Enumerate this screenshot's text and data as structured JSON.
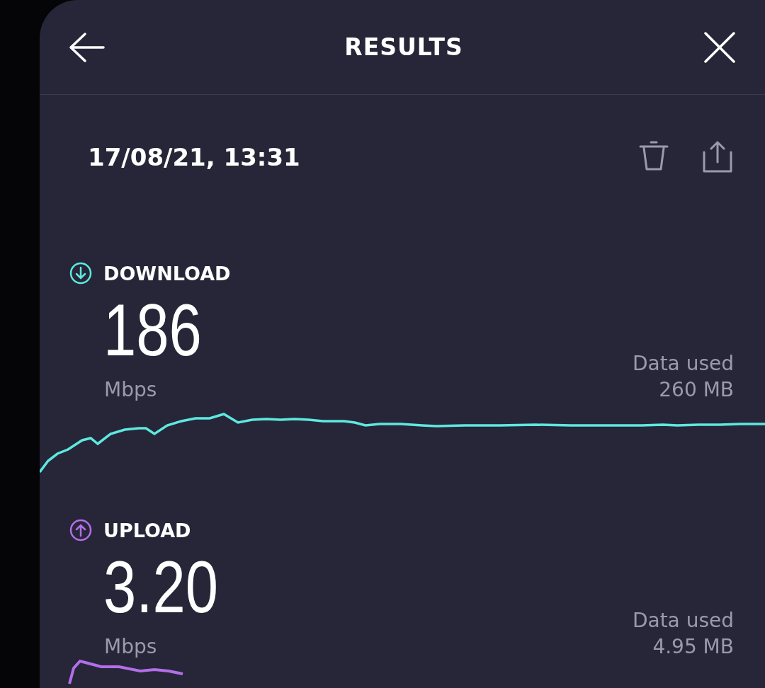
{
  "header": {
    "title": "RESULTS"
  },
  "result": {
    "timestamp": "17/08/21, 13:31"
  },
  "metrics": [
    {
      "kind": "download",
      "label": "DOWNLOAD",
      "value": "186",
      "unit": "Mbps",
      "data_label": "Data used",
      "data_value": "260 MB",
      "color": "#5ee8e0"
    },
    {
      "kind": "upload",
      "label": "UPLOAD",
      "value": "3.20",
      "unit": "Mbps",
      "data_label": "Data used",
      "data_value": "4.95 MB",
      "color": "#b36ee8"
    }
  ]
}
